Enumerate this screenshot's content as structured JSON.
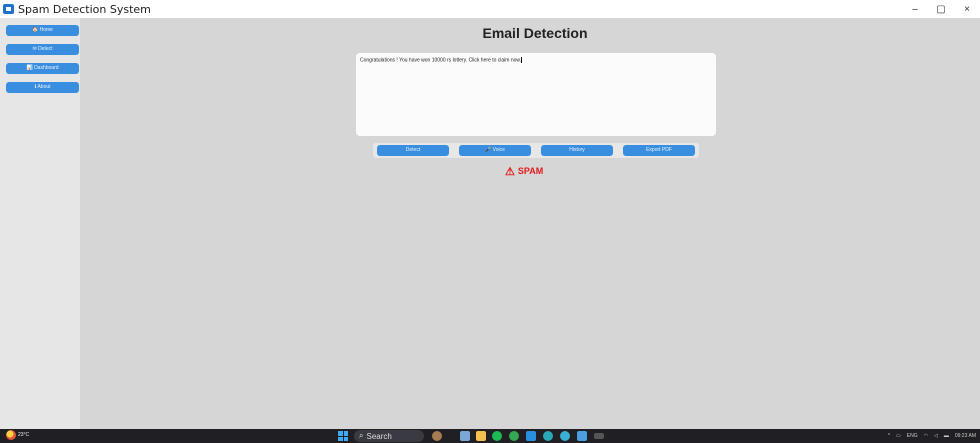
{
  "window": {
    "title": "Spam Detection System",
    "controls": [
      "–",
      "▢",
      "×"
    ]
  },
  "sidebar": {
    "items": [
      {
        "label": "🏠 Home",
        "icon": "home-icon"
      },
      {
        "label": "✉ Detect",
        "icon": "mail-icon"
      },
      {
        "label": "📊 Dashboard",
        "icon": "chart-icon"
      },
      {
        "label": "ℹ About",
        "icon": "info-icon"
      }
    ]
  },
  "main": {
    "title": "Email Detection",
    "email_text": "Congratulations ! You have won 10000 rs lottery.  Click here to claim now.",
    "actions": {
      "detect": "Detect",
      "voice": "🎤 Voice",
      "history": "History",
      "export": "Export PDF"
    },
    "result": {
      "icon": "⚠",
      "label": "SPAM",
      "color": "#e01b1b"
    }
  },
  "taskbar": {
    "temperature": "23°C",
    "search_placeholder": "Search",
    "tray": {
      "language": "ENG",
      "time": "09:23 AM"
    }
  },
  "colors": {
    "accent": "#3a8ee0",
    "background": "#d6d6d6",
    "spam": "#e01b1b"
  }
}
